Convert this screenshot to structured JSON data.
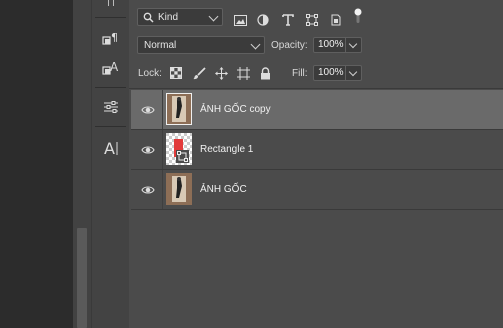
{
  "filter": {
    "kind_label": "Kind"
  },
  "blend": {
    "mode": "Normal",
    "opacity_label": "Opacity:",
    "opacity_value": "100%"
  },
  "lock": {
    "label": "Lock:",
    "fill_label": "Fill:",
    "fill_value": "100%"
  },
  "layers": [
    {
      "name": "ẢNH GỐC copy",
      "selected": true
    },
    {
      "name": "Rectangle 1",
      "selected": false
    },
    {
      "name": "ẢNH GỐC",
      "selected": false
    }
  ],
  "colors": {
    "panel": "#4b4b4b",
    "selected_layer": "#6a6a6a",
    "shape_red": "#e23b3b"
  }
}
